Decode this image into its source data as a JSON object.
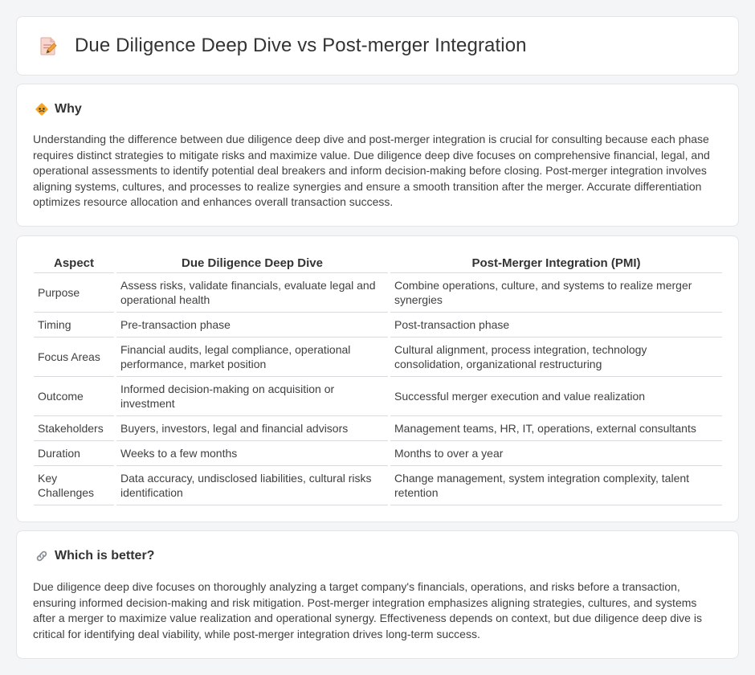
{
  "header": {
    "title": "Due Diligence Deep Dive vs Post-merger Integration",
    "icon": "document-pencil-icon"
  },
  "why": {
    "icon": "warning-diamond-icon",
    "title": "Why",
    "text": "Understanding the difference between due diligence deep dive and post-merger integration is crucial for consulting because each phase requires distinct strategies to mitigate risks and maximize value. Due diligence deep dive focuses on comprehensive financial, legal, and operational assessments to identify potential deal breakers and inform decision-making before closing. Post-merger integration involves aligning systems, cultures, and processes to realize synergies and ensure a smooth transition after the merger. Accurate differentiation optimizes resource allocation and enhances overall transaction success."
  },
  "comparison": {
    "headers": [
      "Aspect",
      "Due Diligence Deep Dive",
      "Post-Merger Integration (PMI)"
    ],
    "rows": [
      [
        "Purpose",
        "Assess risks, validate financials, evaluate legal and operational health",
        "Combine operations, culture, and systems to realize merger synergies"
      ],
      [
        "Timing",
        "Pre-transaction phase",
        "Post-transaction phase"
      ],
      [
        "Focus Areas",
        "Financial audits, legal compliance, operational performance, market position",
        "Cultural alignment, process integration, technology consolidation, organizational restructuring"
      ],
      [
        "Outcome",
        "Informed decision-making on acquisition or investment",
        "Successful merger execution and value realization"
      ],
      [
        "Stakeholders",
        "Buyers, investors, legal and financial advisors",
        "Management teams, HR, IT, operations, external consultants"
      ],
      [
        "Duration",
        "Weeks to a few months",
        "Months to over a year"
      ],
      [
        "Key Challenges",
        "Data accuracy, undisclosed liabilities, cultural risks identification",
        "Change management, system integration complexity, talent retention"
      ]
    ]
  },
  "better": {
    "icon": "link-icon",
    "title": "Which is better?",
    "text": "Due diligence deep dive focuses on thoroughly analyzing a target company's financials, operations, and risks before a transaction, ensuring informed decision-making and risk mitigation. Post-merger integration emphasizes aligning strategies, cultures, and systems after a merger to maximize value realization and operational synergy. Effectiveness depends on context, but due diligence deep dive is critical for identifying deal viability, while post-merger integration drives long-term success."
  },
  "colors": {
    "page_background": "#f4f5f7",
    "card_background": "#ffffff",
    "accent_orange": "#f5a623",
    "text": "#404040"
  }
}
